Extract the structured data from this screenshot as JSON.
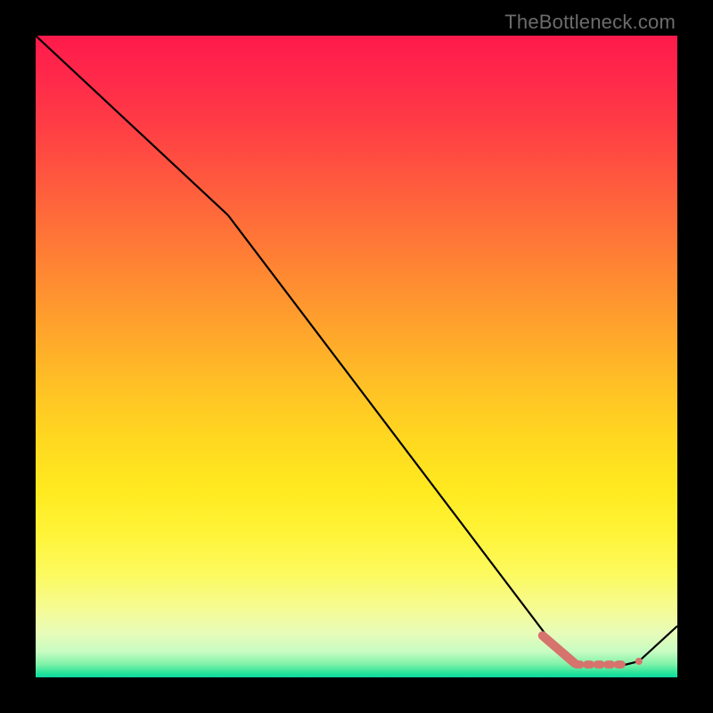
{
  "watermark": "TheBottleneck.com",
  "chart_data": {
    "type": "line",
    "title": "",
    "xlabel": "",
    "ylabel": "",
    "xlim": [
      0,
      100
    ],
    "ylim": [
      0,
      100
    ],
    "series": [
      {
        "name": "curve",
        "x": [
          0,
          30,
          80,
          84,
          92,
          94,
          100
        ],
        "y": [
          100,
          72,
          6,
          2,
          2,
          2.5,
          8
        ]
      }
    ],
    "annotations": [
      {
        "kind": "thick-segment",
        "color": "#d6736d",
        "x0": 79,
        "y0": 6.5,
        "x1": 84,
        "y1": 2.2
      },
      {
        "kind": "dashed-segment",
        "color": "#d6736d",
        "x0": 84,
        "y0": 2.0,
        "x1": 92,
        "y1": 2.0
      },
      {
        "kind": "dot",
        "color": "#d6736d",
        "x": 94,
        "y": 2.5,
        "r": 4
      }
    ],
    "gradient_stops": [
      {
        "pos": 0.0,
        "color": "#ff1a4b"
      },
      {
        "pos": 0.5,
        "color": "#ffcc22"
      },
      {
        "pos": 0.9,
        "color": "#f2fb9a"
      },
      {
        "pos": 1.0,
        "color": "#0cd9a2"
      }
    ]
  }
}
